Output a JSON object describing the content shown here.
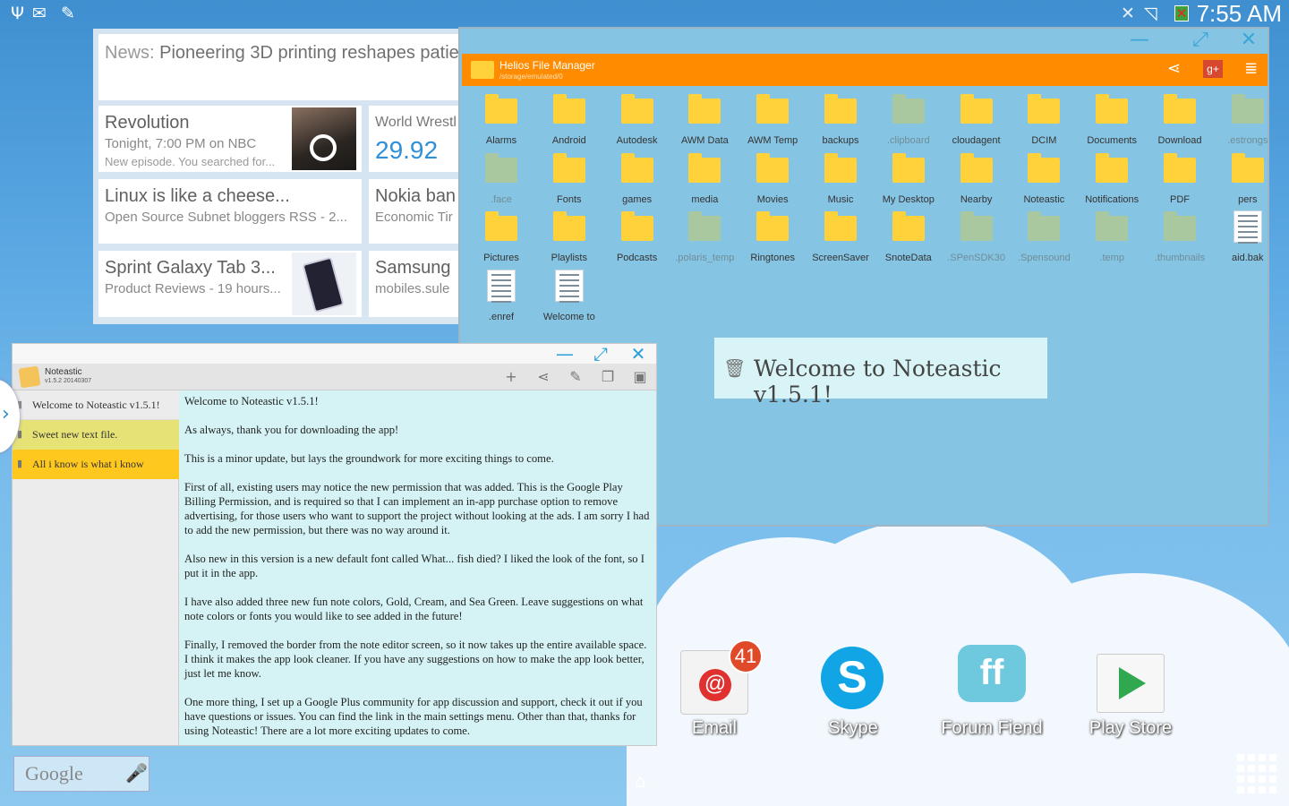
{
  "status_bar": {
    "time": "7:55 AM",
    "left_icons": [
      "usb-icon",
      "mail-settings-icon",
      "pen-icon"
    ],
    "right_icons": [
      "mute-icon",
      "no-signal-icon",
      "battery-icon"
    ]
  },
  "news_widget": {
    "headline_prefix": "News:",
    "headline": "Pioneering 3D printing reshapes patie",
    "cards": [
      {
        "title": "Revolution",
        "subtitle": "Tonight, 7:00 PM on NBC",
        "meta": "New episode. You searched for..."
      },
      {
        "title": "World Wrestl",
        "value": "29.92"
      },
      {
        "title": "Linux is like a cheese...",
        "subtitle": "Open Source Subnet bloggers RSS - 2..."
      },
      {
        "title": "Nokia ban",
        "subtitle": "Economic Tir"
      },
      {
        "title": "Sprint Galaxy Tab 3...",
        "subtitle": "Product Reviews - 19 hours..."
      },
      {
        "title": "Samsung",
        "subtitle": "mobiles.sule"
      }
    ]
  },
  "file_manager": {
    "title": "Helios File Manager",
    "path": "/storage/emulated/0",
    "colors": {
      "toolbar": "#ff8c00",
      "background": "#86c4e3",
      "folder": "#ffd23b"
    },
    "items": [
      {
        "name": "Alarms",
        "type": "folder"
      },
      {
        "name": "Android",
        "type": "folder"
      },
      {
        "name": "Autodesk",
        "type": "folder"
      },
      {
        "name": "AWM Data",
        "type": "folder"
      },
      {
        "name": "AWM Temp",
        "type": "folder"
      },
      {
        "name": "backups",
        "type": "folder"
      },
      {
        "name": ".clipboard",
        "type": "hidden"
      },
      {
        "name": "cloudagent",
        "type": "folder"
      },
      {
        "name": "DCIM",
        "type": "folder"
      },
      {
        "name": "Documents",
        "type": "folder"
      },
      {
        "name": "Download",
        "type": "folder"
      },
      {
        "name": ".estrongs",
        "type": "hidden"
      },
      {
        "name": ".face",
        "type": "hidden"
      },
      {
        "name": "Fonts",
        "type": "folder"
      },
      {
        "name": "games",
        "type": "folder"
      },
      {
        "name": "media",
        "type": "folder"
      },
      {
        "name": "Movies",
        "type": "folder"
      },
      {
        "name": "Music",
        "type": "folder"
      },
      {
        "name": "My Desktop",
        "type": "folder"
      },
      {
        "name": "Nearby",
        "type": "folder"
      },
      {
        "name": "Noteastic",
        "type": "folder"
      },
      {
        "name": "Notifications",
        "type": "folder"
      },
      {
        "name": "PDF",
        "type": "folder"
      },
      {
        "name": "pers",
        "type": "folder"
      },
      {
        "name": "Pictures",
        "type": "folder"
      },
      {
        "name": "Playlists",
        "type": "folder"
      },
      {
        "name": "Podcasts",
        "type": "folder"
      },
      {
        "name": ".polaris_temp",
        "type": "hidden"
      },
      {
        "name": "Ringtones",
        "type": "folder"
      },
      {
        "name": "ScreenSaver",
        "type": "folder"
      },
      {
        "name": "SnoteData",
        "type": "folder"
      },
      {
        "name": ".SPenSDK30",
        "type": "hidden"
      },
      {
        "name": ".Spensound",
        "type": "hidden"
      },
      {
        "name": ".temp",
        "type": "hidden"
      },
      {
        "name": ".thumbnails",
        "type": "hidden"
      },
      {
        "name": "aid.bak",
        "type": "file"
      },
      {
        "name": ".enref",
        "type": "file"
      },
      {
        "name": "Welcome to",
        "type": "file"
      }
    ],
    "toast": "Welcome to Noteastic v1.5.1!"
  },
  "noteastic": {
    "app_name": "Noteastic",
    "version": "v1.5.2 20140307",
    "notes": [
      {
        "title": "Welcome to Noteastic v1.5.1!",
        "color": "#ececec"
      },
      {
        "title": "Sweet new text file.",
        "color": "#e6e276"
      },
      {
        "title": "All i know is what i know",
        "color": "#ffc81e"
      }
    ],
    "content": [
      "Welcome to Noteastic v1.5.1!",
      "As always, thank you for downloading the app!",
      "This is a minor update, but lays the groundwork for more exciting things to come.",
      "First of all, existing users may notice the new permission that was added. This is the Google Play Billing Permission, and is required so that I can implement an in-app purchase option to remove advertising, for those users who want to support the project without looking at the ads. I am sorry I had to add the new permission, but there was no way around it.",
      "Also new in this version is a new default font called What... fish died? I liked the look of the font, so I put it in the app.",
      "I have also added three new fun note colors, Gold, Cream, and Sea Green. Leave suggestions on what note colors or fonts you would like to see added in the future!",
      "Finally, I removed the border from the note editor screen, so it now takes up the entire available space. I think it makes the app look cleaner. If you have any suggestions on how to make the app look better, just let me know.",
      "One more thing, I set up a Google Plus community for app discussion and support, check it out if you have questions or issues. You can find the link in the main settings menu. Other than that, thanks for using Noteastic! There are a lot more exciting updates to come."
    ]
  },
  "desktop": {
    "apps": [
      {
        "label": "Email",
        "badge": "41"
      },
      {
        "label": "Skype"
      },
      {
        "label": "Forum Fiend"
      },
      {
        "label": "Play Store"
      }
    ],
    "google_search": "Google"
  }
}
